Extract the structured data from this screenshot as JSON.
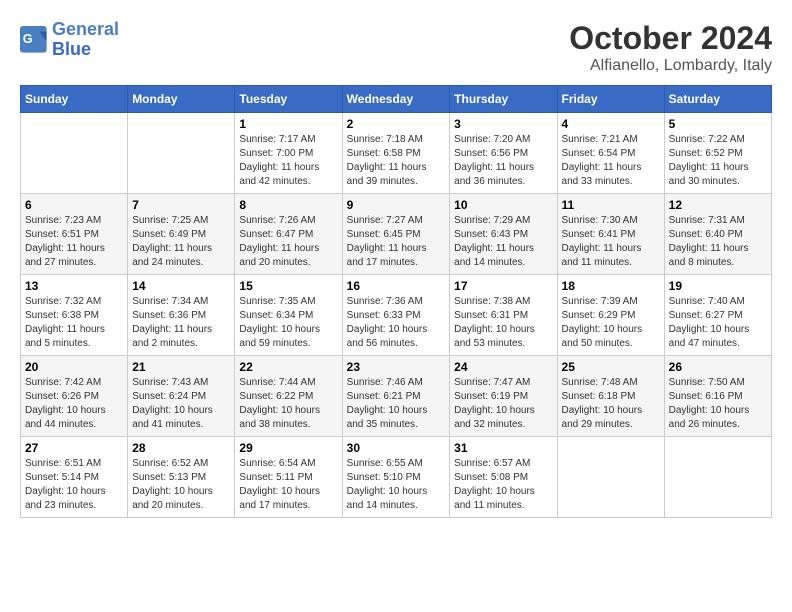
{
  "header": {
    "logo_line1": "General",
    "logo_line2": "Blue",
    "month": "October 2024",
    "location": "Alfianello, Lombardy, Italy"
  },
  "weekdays": [
    "Sunday",
    "Monday",
    "Tuesday",
    "Wednesday",
    "Thursday",
    "Friday",
    "Saturday"
  ],
  "weeks": [
    [
      {
        "day": "",
        "detail": ""
      },
      {
        "day": "",
        "detail": ""
      },
      {
        "day": "1",
        "detail": "Sunrise: 7:17 AM\nSunset: 7:00 PM\nDaylight: 11 hours\nand 42 minutes."
      },
      {
        "day": "2",
        "detail": "Sunrise: 7:18 AM\nSunset: 6:58 PM\nDaylight: 11 hours\nand 39 minutes."
      },
      {
        "day": "3",
        "detail": "Sunrise: 7:20 AM\nSunset: 6:56 PM\nDaylight: 11 hours\nand 36 minutes."
      },
      {
        "day": "4",
        "detail": "Sunrise: 7:21 AM\nSunset: 6:54 PM\nDaylight: 11 hours\nand 33 minutes."
      },
      {
        "day": "5",
        "detail": "Sunrise: 7:22 AM\nSunset: 6:52 PM\nDaylight: 11 hours\nand 30 minutes."
      }
    ],
    [
      {
        "day": "6",
        "detail": "Sunrise: 7:23 AM\nSunset: 6:51 PM\nDaylight: 11 hours\nand 27 minutes."
      },
      {
        "day": "7",
        "detail": "Sunrise: 7:25 AM\nSunset: 6:49 PM\nDaylight: 11 hours\nand 24 minutes."
      },
      {
        "day": "8",
        "detail": "Sunrise: 7:26 AM\nSunset: 6:47 PM\nDaylight: 11 hours\nand 20 minutes."
      },
      {
        "day": "9",
        "detail": "Sunrise: 7:27 AM\nSunset: 6:45 PM\nDaylight: 11 hours\nand 17 minutes."
      },
      {
        "day": "10",
        "detail": "Sunrise: 7:29 AM\nSunset: 6:43 PM\nDaylight: 11 hours\nand 14 minutes."
      },
      {
        "day": "11",
        "detail": "Sunrise: 7:30 AM\nSunset: 6:41 PM\nDaylight: 11 hours\nand 11 minutes."
      },
      {
        "day": "12",
        "detail": "Sunrise: 7:31 AM\nSunset: 6:40 PM\nDaylight: 11 hours\nand 8 minutes."
      }
    ],
    [
      {
        "day": "13",
        "detail": "Sunrise: 7:32 AM\nSunset: 6:38 PM\nDaylight: 11 hours\nand 5 minutes."
      },
      {
        "day": "14",
        "detail": "Sunrise: 7:34 AM\nSunset: 6:36 PM\nDaylight: 11 hours\nand 2 minutes."
      },
      {
        "day": "15",
        "detail": "Sunrise: 7:35 AM\nSunset: 6:34 PM\nDaylight: 10 hours\nand 59 minutes."
      },
      {
        "day": "16",
        "detail": "Sunrise: 7:36 AM\nSunset: 6:33 PM\nDaylight: 10 hours\nand 56 minutes."
      },
      {
        "day": "17",
        "detail": "Sunrise: 7:38 AM\nSunset: 6:31 PM\nDaylight: 10 hours\nand 53 minutes."
      },
      {
        "day": "18",
        "detail": "Sunrise: 7:39 AM\nSunset: 6:29 PM\nDaylight: 10 hours\nand 50 minutes."
      },
      {
        "day": "19",
        "detail": "Sunrise: 7:40 AM\nSunset: 6:27 PM\nDaylight: 10 hours\nand 47 minutes."
      }
    ],
    [
      {
        "day": "20",
        "detail": "Sunrise: 7:42 AM\nSunset: 6:26 PM\nDaylight: 10 hours\nand 44 minutes."
      },
      {
        "day": "21",
        "detail": "Sunrise: 7:43 AM\nSunset: 6:24 PM\nDaylight: 10 hours\nand 41 minutes."
      },
      {
        "day": "22",
        "detail": "Sunrise: 7:44 AM\nSunset: 6:22 PM\nDaylight: 10 hours\nand 38 minutes."
      },
      {
        "day": "23",
        "detail": "Sunrise: 7:46 AM\nSunset: 6:21 PM\nDaylight: 10 hours\nand 35 minutes."
      },
      {
        "day": "24",
        "detail": "Sunrise: 7:47 AM\nSunset: 6:19 PM\nDaylight: 10 hours\nand 32 minutes."
      },
      {
        "day": "25",
        "detail": "Sunrise: 7:48 AM\nSunset: 6:18 PM\nDaylight: 10 hours\nand 29 minutes."
      },
      {
        "day": "26",
        "detail": "Sunrise: 7:50 AM\nSunset: 6:16 PM\nDaylight: 10 hours\nand 26 minutes."
      }
    ],
    [
      {
        "day": "27",
        "detail": "Sunrise: 6:51 AM\nSunset: 5:14 PM\nDaylight: 10 hours\nand 23 minutes."
      },
      {
        "day": "28",
        "detail": "Sunrise: 6:52 AM\nSunset: 5:13 PM\nDaylight: 10 hours\nand 20 minutes."
      },
      {
        "day": "29",
        "detail": "Sunrise: 6:54 AM\nSunset: 5:11 PM\nDaylight: 10 hours\nand 17 minutes."
      },
      {
        "day": "30",
        "detail": "Sunrise: 6:55 AM\nSunset: 5:10 PM\nDaylight: 10 hours\nand 14 minutes."
      },
      {
        "day": "31",
        "detail": "Sunrise: 6:57 AM\nSunset: 5:08 PM\nDaylight: 10 hours\nand 11 minutes."
      },
      {
        "day": "",
        "detail": ""
      },
      {
        "day": "",
        "detail": ""
      }
    ]
  ]
}
